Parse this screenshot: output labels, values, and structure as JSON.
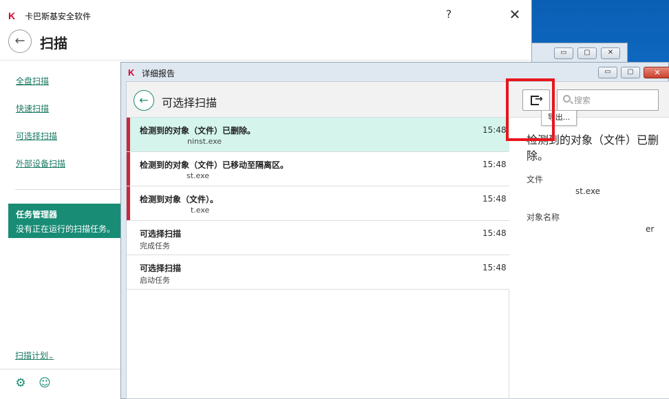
{
  "main_window": {
    "title": "卡巴斯基安全软件",
    "help": "?",
    "close": "✕",
    "back": "←",
    "page_title": "扫描",
    "sidebar": {
      "links": [
        "全盘扫描",
        "快速扫描",
        "可选择扫描",
        "外部设备扫描"
      ],
      "task_manager": {
        "title": "任务管理器",
        "subtitle": "没有正在运行的扫描任务。"
      },
      "scan_schedule": "扫描计划"
    }
  },
  "background_window": {
    "buttons": [
      "▭",
      "▢",
      "✕"
    ]
  },
  "report_window": {
    "title": "详细报告",
    "close": "✕",
    "caption_buttons": [
      "▭",
      "▢"
    ],
    "header": {
      "back": "←",
      "title": "可选择扫描"
    },
    "toolbar": {
      "export_tooltip": "导出...",
      "search_placeholder": "搜索"
    },
    "events": [
      {
        "title": "检测到的对象（文件）已删除。",
        "subtitle": "ninst.exe",
        "time": "15:48",
        "flag": true,
        "selected": true
      },
      {
        "title": "检测到的对象（文件）已移动至隔离区。",
        "subtitle": "st.exe",
        "time": "15:48",
        "flag": true,
        "selected": false
      },
      {
        "title": "检测到对象（文件）。",
        "subtitle": "t.exe",
        "time": "15:48",
        "flag": true,
        "selected": false
      },
      {
        "title": "可选择扫描",
        "subtitle": "完成任务",
        "time": "15:48",
        "flag": false,
        "selected": false
      },
      {
        "title": "可选择扫描",
        "subtitle": "启动任务",
        "time": "15:48",
        "flag": false,
        "selected": false
      }
    ],
    "details": {
      "title": "检测到的对象（文件）已删除。",
      "file_label": "文件",
      "file_value": "st.exe",
      "object_label": "对象名称",
      "object_value": "er"
    }
  },
  "colors": {
    "accent": "#188c75",
    "flag": "#c8283e",
    "highlight": "#e8151d",
    "selected_row": "#d4f4ec"
  }
}
